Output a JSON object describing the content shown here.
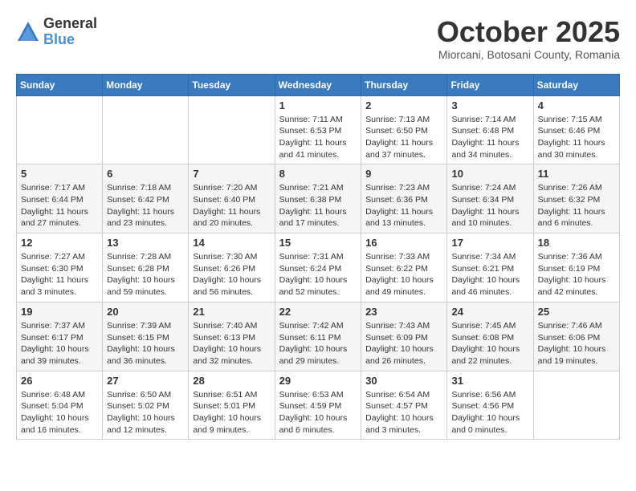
{
  "header": {
    "logo_general": "General",
    "logo_blue": "Blue",
    "month": "October 2025",
    "location": "Miorcani, Botosani County, Romania"
  },
  "weekdays": [
    "Sunday",
    "Monday",
    "Tuesday",
    "Wednesday",
    "Thursday",
    "Friday",
    "Saturday"
  ],
  "weeks": [
    [
      {
        "day": "",
        "info": ""
      },
      {
        "day": "",
        "info": ""
      },
      {
        "day": "",
        "info": ""
      },
      {
        "day": "1",
        "info": "Sunrise: 7:11 AM\nSunset: 6:53 PM\nDaylight: 11 hours and 41 minutes."
      },
      {
        "day": "2",
        "info": "Sunrise: 7:13 AM\nSunset: 6:50 PM\nDaylight: 11 hours and 37 minutes."
      },
      {
        "day": "3",
        "info": "Sunrise: 7:14 AM\nSunset: 6:48 PM\nDaylight: 11 hours and 34 minutes."
      },
      {
        "day": "4",
        "info": "Sunrise: 7:15 AM\nSunset: 6:46 PM\nDaylight: 11 hours and 30 minutes."
      }
    ],
    [
      {
        "day": "5",
        "info": "Sunrise: 7:17 AM\nSunset: 6:44 PM\nDaylight: 11 hours and 27 minutes."
      },
      {
        "day": "6",
        "info": "Sunrise: 7:18 AM\nSunset: 6:42 PM\nDaylight: 11 hours and 23 minutes."
      },
      {
        "day": "7",
        "info": "Sunrise: 7:20 AM\nSunset: 6:40 PM\nDaylight: 11 hours and 20 minutes."
      },
      {
        "day": "8",
        "info": "Sunrise: 7:21 AM\nSunset: 6:38 PM\nDaylight: 11 hours and 17 minutes."
      },
      {
        "day": "9",
        "info": "Sunrise: 7:23 AM\nSunset: 6:36 PM\nDaylight: 11 hours and 13 minutes."
      },
      {
        "day": "10",
        "info": "Sunrise: 7:24 AM\nSunset: 6:34 PM\nDaylight: 11 hours and 10 minutes."
      },
      {
        "day": "11",
        "info": "Sunrise: 7:26 AM\nSunset: 6:32 PM\nDaylight: 11 hours and 6 minutes."
      }
    ],
    [
      {
        "day": "12",
        "info": "Sunrise: 7:27 AM\nSunset: 6:30 PM\nDaylight: 11 hours and 3 minutes."
      },
      {
        "day": "13",
        "info": "Sunrise: 7:28 AM\nSunset: 6:28 PM\nDaylight: 10 hours and 59 minutes."
      },
      {
        "day": "14",
        "info": "Sunrise: 7:30 AM\nSunset: 6:26 PM\nDaylight: 10 hours and 56 minutes."
      },
      {
        "day": "15",
        "info": "Sunrise: 7:31 AM\nSunset: 6:24 PM\nDaylight: 10 hours and 52 minutes."
      },
      {
        "day": "16",
        "info": "Sunrise: 7:33 AM\nSunset: 6:22 PM\nDaylight: 10 hours and 49 minutes."
      },
      {
        "day": "17",
        "info": "Sunrise: 7:34 AM\nSunset: 6:21 PM\nDaylight: 10 hours and 46 minutes."
      },
      {
        "day": "18",
        "info": "Sunrise: 7:36 AM\nSunset: 6:19 PM\nDaylight: 10 hours and 42 minutes."
      }
    ],
    [
      {
        "day": "19",
        "info": "Sunrise: 7:37 AM\nSunset: 6:17 PM\nDaylight: 10 hours and 39 minutes."
      },
      {
        "day": "20",
        "info": "Sunrise: 7:39 AM\nSunset: 6:15 PM\nDaylight: 10 hours and 36 minutes."
      },
      {
        "day": "21",
        "info": "Sunrise: 7:40 AM\nSunset: 6:13 PM\nDaylight: 10 hours and 32 minutes."
      },
      {
        "day": "22",
        "info": "Sunrise: 7:42 AM\nSunset: 6:11 PM\nDaylight: 10 hours and 29 minutes."
      },
      {
        "day": "23",
        "info": "Sunrise: 7:43 AM\nSunset: 6:09 PM\nDaylight: 10 hours and 26 minutes."
      },
      {
        "day": "24",
        "info": "Sunrise: 7:45 AM\nSunset: 6:08 PM\nDaylight: 10 hours and 22 minutes."
      },
      {
        "day": "25",
        "info": "Sunrise: 7:46 AM\nSunset: 6:06 PM\nDaylight: 10 hours and 19 minutes."
      }
    ],
    [
      {
        "day": "26",
        "info": "Sunrise: 6:48 AM\nSunset: 5:04 PM\nDaylight: 10 hours and 16 minutes."
      },
      {
        "day": "27",
        "info": "Sunrise: 6:50 AM\nSunset: 5:02 PM\nDaylight: 10 hours and 12 minutes."
      },
      {
        "day": "28",
        "info": "Sunrise: 6:51 AM\nSunset: 5:01 PM\nDaylight: 10 hours and 9 minutes."
      },
      {
        "day": "29",
        "info": "Sunrise: 6:53 AM\nSunset: 4:59 PM\nDaylight: 10 hours and 6 minutes."
      },
      {
        "day": "30",
        "info": "Sunrise: 6:54 AM\nSunset: 4:57 PM\nDaylight: 10 hours and 3 minutes."
      },
      {
        "day": "31",
        "info": "Sunrise: 6:56 AM\nSunset: 4:56 PM\nDaylight: 10 hours and 0 minutes."
      },
      {
        "day": "",
        "info": ""
      }
    ]
  ]
}
